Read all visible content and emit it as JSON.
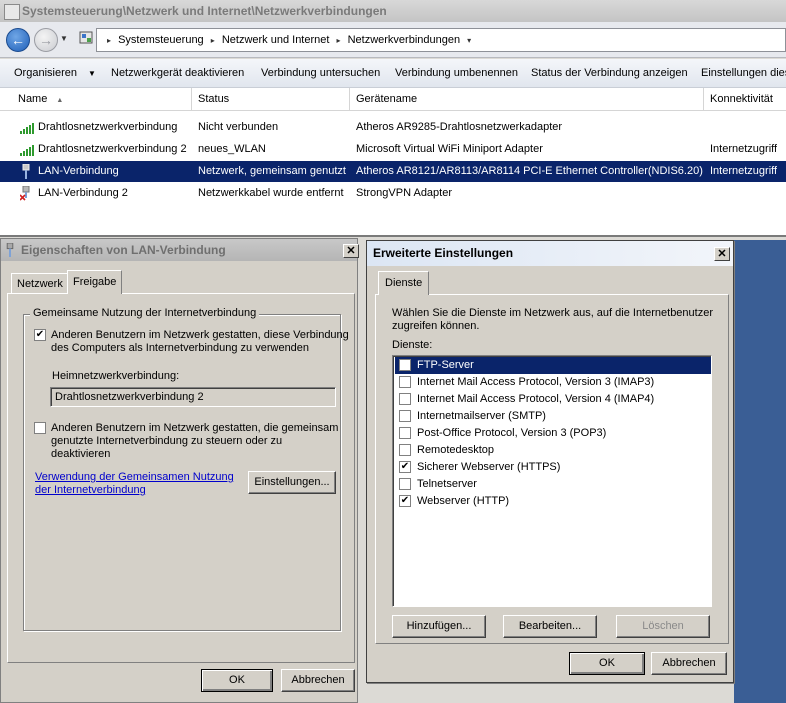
{
  "window": {
    "title": "Systemsteuerung\\Netzwerk und Internet\\Netzwerkverbindungen"
  },
  "address": {
    "crumbs": [
      "Systemsteuerung",
      "Netzwerk und Internet",
      "Netzwerkverbindungen"
    ]
  },
  "toolbar": {
    "organize": "Organisieren",
    "deactivate": "Netzwerkgerät deaktivieren",
    "diagnose": "Verbindung untersuchen",
    "rename": "Verbindung umbenennen",
    "status": "Status der Verbindung anzeigen",
    "settings": "Einstellungen dies"
  },
  "columns": {
    "name": "Name",
    "status": "Status",
    "device": "Gerätename",
    "connectivity": "Konnektivität"
  },
  "connections": [
    {
      "name": "Drahtlosnetzwerkverbindung",
      "status": "Nicht verbunden",
      "device": "Atheros AR9285-Drahtlosnetzwerkadapter",
      "connectivity": "",
      "icon": "wifi-signal-icon"
    },
    {
      "name": "Drahtlosnetzwerkverbindung 2",
      "status": "neues_WLAN",
      "device": "Microsoft Virtual WiFi Miniport Adapter",
      "connectivity": "Internetzugriff",
      "icon": "wifi-signal-icon"
    },
    {
      "name": "LAN-Verbindung",
      "status": "Netzwerk, gemeinsam genutzt",
      "device": "Atheros AR8121/AR8113/AR8114 PCI-E Ethernet Controller(NDIS6.20)",
      "connectivity": "Internetzugriff",
      "icon": "lan-cable-icon"
    },
    {
      "name": "LAN-Verbindung 2",
      "status": "Netzwerkkabel wurde entfernt",
      "device": "StrongVPN Adapter",
      "connectivity": "",
      "icon": "lan-disconnected-icon"
    }
  ],
  "props_dialog": {
    "title": "Eigenschaften von LAN-Verbindung",
    "close": "✕",
    "tabs": [
      "Netzwerk",
      "Freigabe"
    ],
    "group_label": "Gemeinsame Nutzung der Internetverbindung",
    "allow_sharing_line1": "Anderen Benutzern im Netzwerk gestatten, diese Verbindung",
    "allow_sharing_line2": "des Computers als Internetverbindung zu verwenden",
    "home_network_label": "Heimnetzwerkverbindung:",
    "home_network_value": "Drahtlosnetzwerkverbindung 2",
    "allow_control_line1": "Anderen Benutzern im Netzwerk gestatten, die gemeinsam",
    "allow_control_line2": "genutzte Internetverbindung zu steuern oder zu",
    "allow_control_line3": "deaktivieren",
    "help_link_line1": "Verwendung der Gemeinsamen Nutzung",
    "help_link_line2": "der Internetverbindung",
    "settings_button": "Einstellungen...",
    "ok_button": "OK",
    "cancel_button": "Abbrechen"
  },
  "adv_dialog": {
    "title": "Erweiterte Einstellungen",
    "close": "✕",
    "tab": "Dienste",
    "description_line1": "Wählen Sie die Dienste im Netzwerk aus, auf die Internetbenutzer",
    "description_line2": "zugreifen können.",
    "services_label": "Dienste:",
    "services": [
      {
        "label": "FTP-Server",
        "checked": false,
        "selected": true
      },
      {
        "label": "Internet Mail Access Protocol, Version 3 (IMAP3)",
        "checked": false,
        "selected": false
      },
      {
        "label": "Internet Mail Access Protocol, Version 4 (IMAP4)",
        "checked": false,
        "selected": false
      },
      {
        "label": "Internetmailserver (SMTP)",
        "checked": false,
        "selected": false
      },
      {
        "label": "Post-Office Protocol, Version 3 (POP3)",
        "checked": false,
        "selected": false
      },
      {
        "label": "Remotedesktop",
        "checked": false,
        "selected": false
      },
      {
        "label": "Sicherer Webserver (HTTPS)",
        "checked": true,
        "selected": false
      },
      {
        "label": "Telnetserver",
        "checked": false,
        "selected": false
      },
      {
        "label": "Webserver (HTTP)",
        "checked": true,
        "selected": false
      }
    ],
    "add_button": "Hinzufügen...",
    "edit_button": "Bearbeiten...",
    "delete_button": "Löschen",
    "ok_button": "OK",
    "cancel_button": "Abbrechen"
  }
}
